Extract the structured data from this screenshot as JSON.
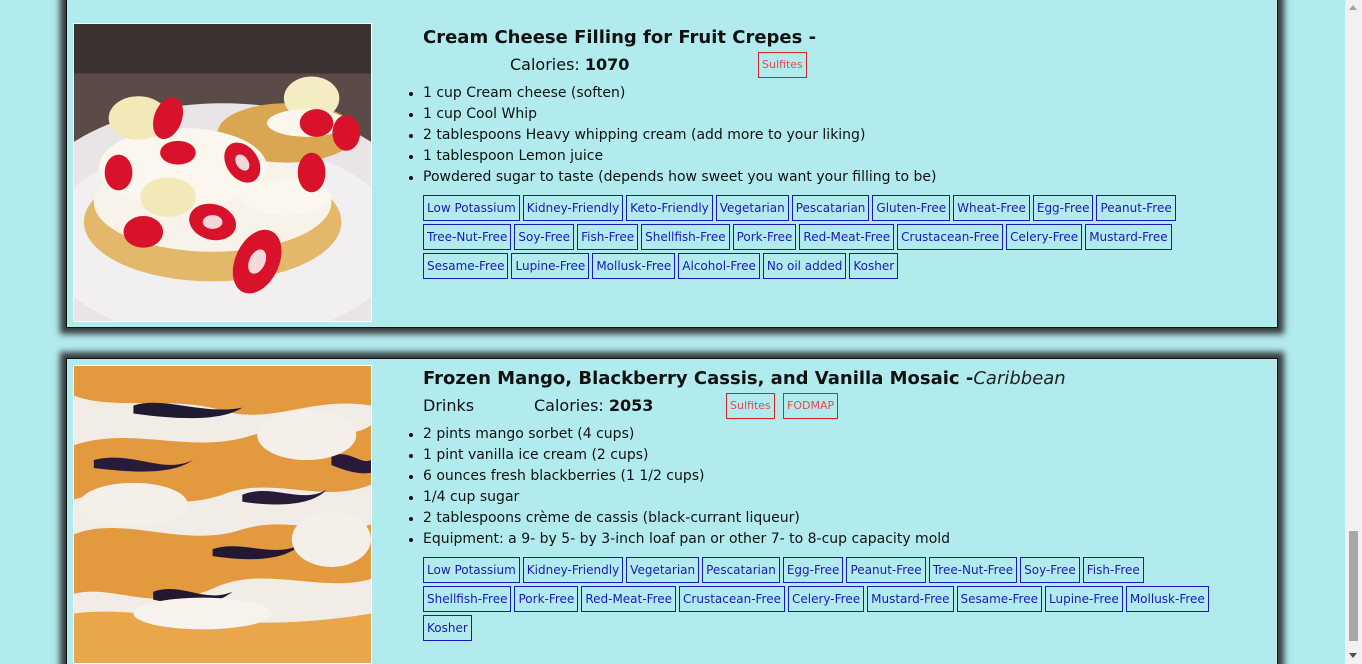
{
  "recipes": [
    {
      "title": "Cream Cheese Filling for Fruit Crepes -",
      "cuisine": "",
      "category": "",
      "calories_label": "Calories: ",
      "calories": "1070",
      "cautions": [
        "Sulfites"
      ],
      "ingredients": [
        "1 cup Cream cheese (soften)",
        "1 cup Cool Whip",
        "2 tablespoons Heavy whipping cream (add more to your liking)",
        "1 tablespoon Lemon juice",
        "Powdered sugar to taste (depends how sweet you want your filling to be)"
      ],
      "health_labels": [
        "Low Potassium",
        "Kidney-Friendly",
        "Keto-Friendly",
        "Vegetarian",
        "Pescatarian",
        "Gluten-Free",
        "Wheat-Free",
        "Egg-Free",
        "Peanut-Free",
        "Tree-Nut-Free",
        "Soy-Free",
        "Fish-Free",
        "Shellfish-Free",
        "Pork-Free",
        "Red-Meat-Free",
        "Crustacean-Free",
        "Celery-Free",
        "Mustard-Free",
        "Sesame-Free",
        "Lupine-Free",
        "Mollusk-Free",
        "Alcohol-Free",
        "No oil added",
        "Kosher"
      ],
      "image_icon": "crepes-with-strawberries-photo"
    },
    {
      "title": "Frozen Mango, Blackberry Cassis, and Vanilla Mosaic -",
      "cuisine": "Caribbean",
      "category": "Drinks",
      "calories_label": "Calories: ",
      "calories": "2053",
      "cautions": [
        "Sulfites",
        "FODMAP"
      ],
      "ingredients": [
        "2 pints mango sorbet (4 cups)",
        "1 pint vanilla ice cream (2 cups)",
        "6 ounces fresh blackberries (1 1/2 cups)",
        "1/4 cup sugar",
        "2 tablespoons crème de cassis (black-currant liqueur)",
        "Equipment: a 9- by 5- by 3-inch loaf pan or other 7- to 8-cup capacity mold"
      ],
      "health_labels": [
        "Low Potassium",
        "Kidney-Friendly",
        "Vegetarian",
        "Pescatarian",
        "Egg-Free",
        "Peanut-Free",
        "Tree-Nut-Free",
        "Soy-Free",
        "Fish-Free",
        "Shellfish-Free",
        "Pork-Free",
        "Red-Meat-Free",
        "Crustacean-Free",
        "Celery-Free",
        "Mustard-Free",
        "Sesame-Free",
        "Lupine-Free",
        "Mollusk-Free",
        "Kosher"
      ],
      "image_icon": "frozen-mosaic-dessert-photo"
    }
  ],
  "colors": {
    "page_background": "#b2ebee",
    "health_label": "#1a1ab8",
    "caution_label": "#d02525"
  }
}
